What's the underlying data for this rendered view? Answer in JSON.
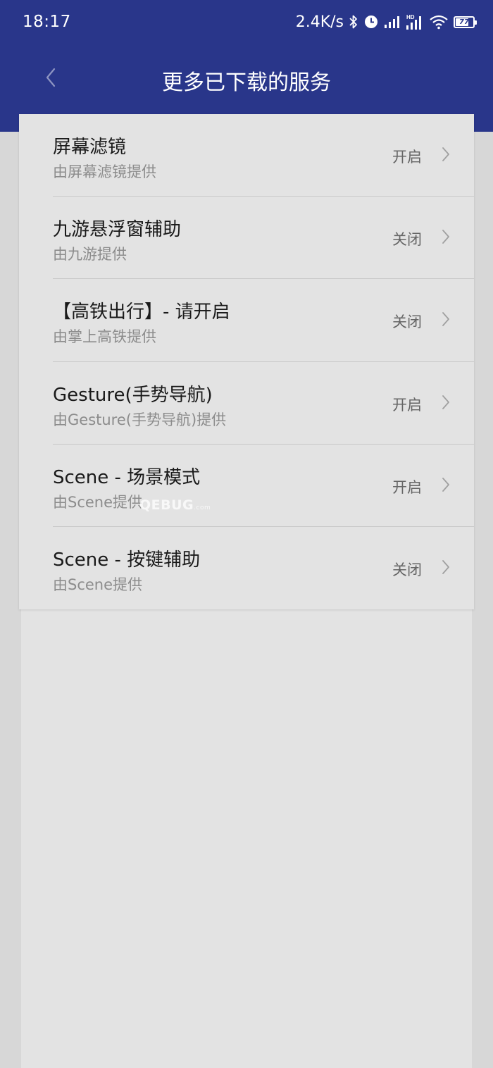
{
  "status_bar": {
    "time": "18:17",
    "net_speed": "2.4K/s",
    "battery_level": "77",
    "icons": [
      "bluetooth-icon",
      "alarm-icon",
      "signal-icon",
      "hd-signal-icon",
      "wifi-icon",
      "battery-icon"
    ]
  },
  "header": {
    "title": "更多已下载的服务",
    "back_icon": "chevron-left-icon"
  },
  "services": [
    {
      "name": "屏幕滤镜",
      "provider": "由屏幕滤镜提供",
      "status": "开启"
    },
    {
      "name": "九游悬浮窗辅助",
      "provider": "由九游提供",
      "status": "关闭"
    },
    {
      "name": "【高铁出行】- 请开启",
      "provider": "由掌上高铁提供",
      "status": "关闭"
    },
    {
      "name": "Gesture(手势导航)",
      "provider": "由Gesture(手势导航)提供",
      "status": "开启"
    },
    {
      "name": "Scene - 场景模式",
      "provider": "由Scene提供",
      "status": "开启"
    },
    {
      "name": "Scene - 按键辅助",
      "provider": "由Scene提供",
      "status": "关闭"
    }
  ],
  "watermark": {
    "main": "QEBUG",
    "sub": ".com"
  },
  "colors": {
    "header": "#29368a",
    "page_bg": "#d7d7d7",
    "card_bg": "#e3e3e3",
    "title_text": "#1a1a1a",
    "sub_text": "#8c8c8c"
  }
}
